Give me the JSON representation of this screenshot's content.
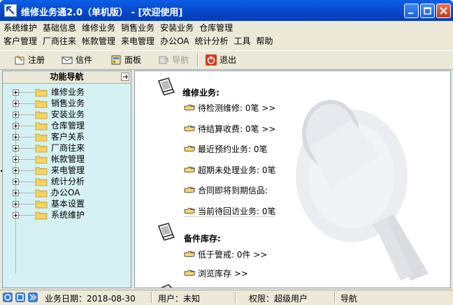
{
  "window": {
    "title": "维修业务通2.0（单机版） - [欢迎使用]"
  },
  "menubar_row1": [
    "系统维护",
    "基础信息",
    "维修业务",
    "销售业务",
    "安装业务",
    "仓库管理"
  ],
  "menubar_row2": [
    "客户管理",
    "厂商往来",
    "帐款管理",
    "来电管理",
    "办公OA",
    "统计分析",
    "工具",
    "帮助"
  ],
  "toolbar": {
    "register": "注册",
    "letter": "信件",
    "panel": "面板",
    "navigate": "导航",
    "exit": "退出"
  },
  "nav": {
    "title": "功能导航",
    "pin": "ᵖ",
    "items": [
      "维修业务",
      "销售业务",
      "安装业务",
      "仓库管理",
      "客户关系",
      "厂商往来",
      "帐款管理",
      "来电管理",
      "统计分析",
      "办公OA",
      "基本设置",
      "系统维护"
    ]
  },
  "main": {
    "repair_title": "维修业务:",
    "repair_items": [
      "待检测维修: 0笔 >>",
      "待结算收费: 0笔 >>",
      "最近预约业务: 0笔",
      "超期未处理业务: 0笔",
      "合同即将到期信品:",
      "当前待回访业务: 0笔"
    ],
    "stock_title": "备件库存:",
    "stock_items": [
      "低于警戒: 0件 >>",
      "浏览库存 >>"
    ]
  },
  "status": {
    "date": "业务日期：2018-08-30",
    "user": "用户：未知",
    "role": "权限：超级用户",
    "mode": "导航"
  },
  "colors": {
    "titlebar": "#0A4ED0",
    "nav_bg": "#D6F1F3",
    "folder": "#F7D560"
  }
}
